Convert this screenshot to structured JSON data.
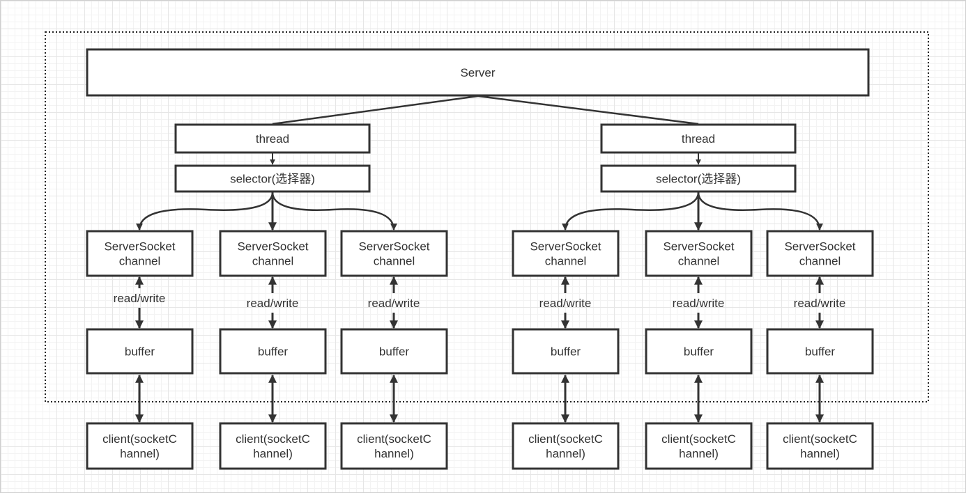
{
  "server": {
    "label": "Server"
  },
  "groups": [
    {
      "thread": "thread",
      "selector": "selector(选择器)",
      "columns": [
        {
          "channel": [
            "ServerSocket",
            "channel"
          ],
          "rw": "read/write",
          "buffer": "buffer",
          "client": [
            "client(socketC",
            "hannel)"
          ]
        },
        {
          "channel": [
            "ServerSocket",
            "channel"
          ],
          "rw": "read/write",
          "buffer": "buffer",
          "client": [
            "client(socketC",
            "hannel)"
          ]
        },
        {
          "channel": [
            "ServerSocket",
            "channel"
          ],
          "rw": "read/write",
          "buffer": "buffer",
          "client": [
            "client(socketC",
            "hannel)"
          ]
        }
      ]
    },
    {
      "thread": "thread",
      "selector": "selector(选择器)",
      "columns": [
        {
          "channel": [
            "ServerSocket",
            "channel"
          ],
          "rw": "read/write",
          "buffer": "buffer",
          "client": [
            "client(socketC",
            "hannel)"
          ]
        },
        {
          "channel": [
            "ServerSocket",
            "channel"
          ],
          "rw": "read/write",
          "buffer": "buffer",
          "client": [
            "client(socketC",
            "hannel)"
          ]
        },
        {
          "channel": [
            "ServerSocket",
            "channel"
          ],
          "rw": "read/write",
          "buffer": "buffer",
          "client": [
            "client(socketC",
            "hannel)"
          ]
        }
      ]
    }
  ],
  "colors": {
    "stroke": "#333333",
    "text": "#333333",
    "background": "#ffffff"
  }
}
